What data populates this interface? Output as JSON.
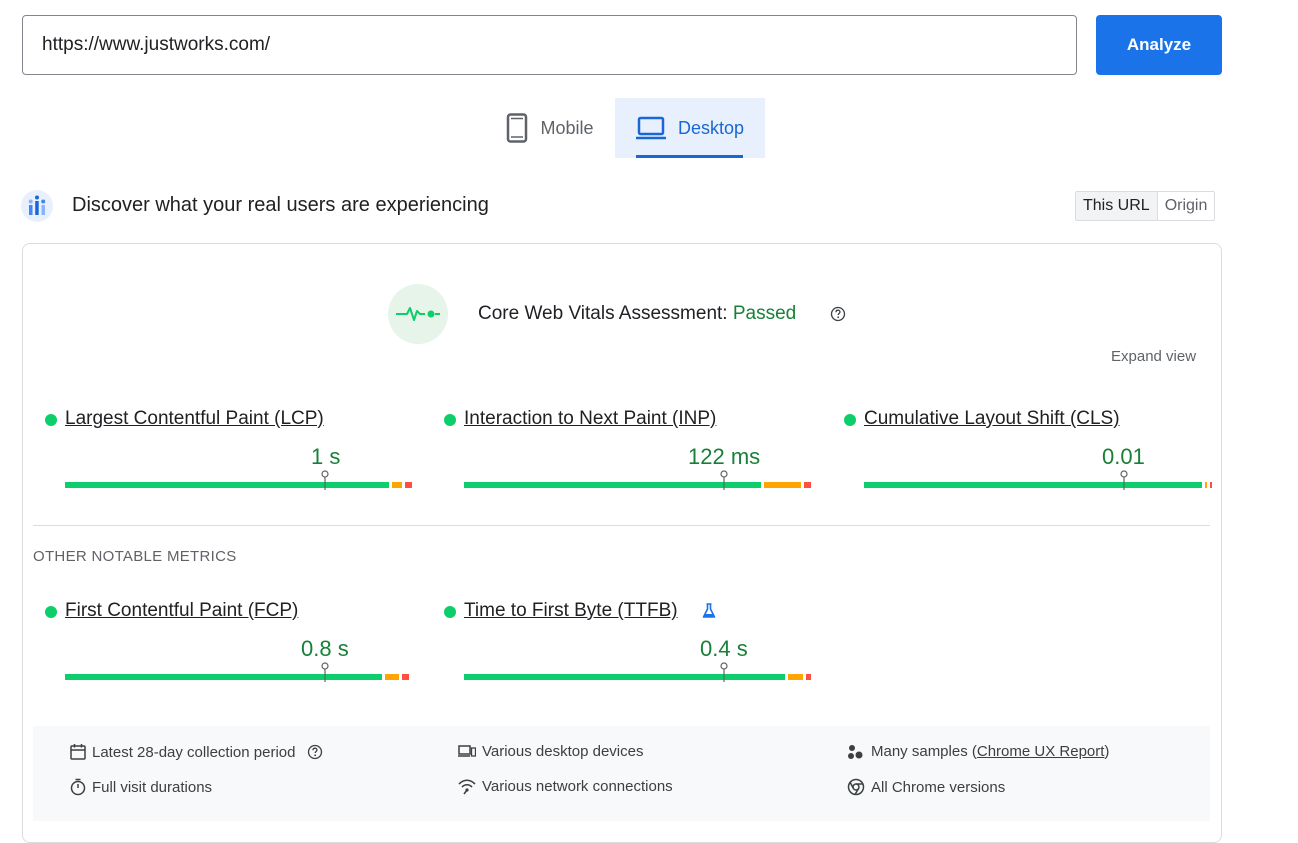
{
  "search": {
    "url_value": "https://www.justworks.com/",
    "analyze_label": "Analyze"
  },
  "device_tabs": {
    "mobile_label": "Mobile",
    "desktop_label": "Desktop",
    "selected": "Desktop"
  },
  "field_data": {
    "title": "Discover what your real users are experiencing",
    "toggle": {
      "this_url": "This URL",
      "origin": "Origin",
      "selected": "This URL"
    }
  },
  "assessment": {
    "label": "Core Web Vitals Assessment:",
    "status": "Passed",
    "expand_label": "Expand view"
  },
  "core_metrics": [
    {
      "name": "Largest Contentful Paint (LCP)",
      "value": "1 s",
      "status": "good",
      "distribution": {
        "good": 0.95,
        "needs_improvement": 0.03,
        "poor": 0.02
      }
    },
    {
      "name": "Interaction to Next Paint (INP)",
      "value": "122 ms",
      "status": "good",
      "distribution": {
        "good": 0.87,
        "needs_improvement": 0.11,
        "poor": 0.02
      }
    },
    {
      "name": "Cumulative Layout Shift (CLS)",
      "value": "0.01",
      "status": "good",
      "distribution": {
        "good": 0.99,
        "needs_improvement": 0.007,
        "poor": 0.003
      }
    }
  ],
  "other_label": "OTHER NOTABLE METRICS",
  "other_metrics": [
    {
      "name": "First Contentful Paint (FCP)",
      "value": "0.8 s",
      "status": "good",
      "distribution": {
        "good": 0.93,
        "needs_improvement": 0.04,
        "poor": 0.02
      }
    },
    {
      "name": "Time to First Byte (TTFB)",
      "value": "0.4 s",
      "status": "good",
      "experimental": true,
      "distribution": {
        "good": 0.94,
        "needs_improvement": 0.045,
        "poor": 0.015
      }
    }
  ],
  "footer": {
    "collection_period": "Latest 28-day collection period",
    "devices": "Various desktop devices",
    "samples_prefix": "Many samples (",
    "samples_link": "Chrome UX Report",
    "samples_suffix": ")",
    "visit_durations": "Full visit durations",
    "network": "Various network connections",
    "chrome_versions": "All Chrome versions"
  },
  "colors": {
    "accent": "#1a73e8",
    "good": "#0cce6b",
    "good_text": "#188038",
    "needs_improvement": "#ffa400",
    "poor": "#ff4e42"
  }
}
